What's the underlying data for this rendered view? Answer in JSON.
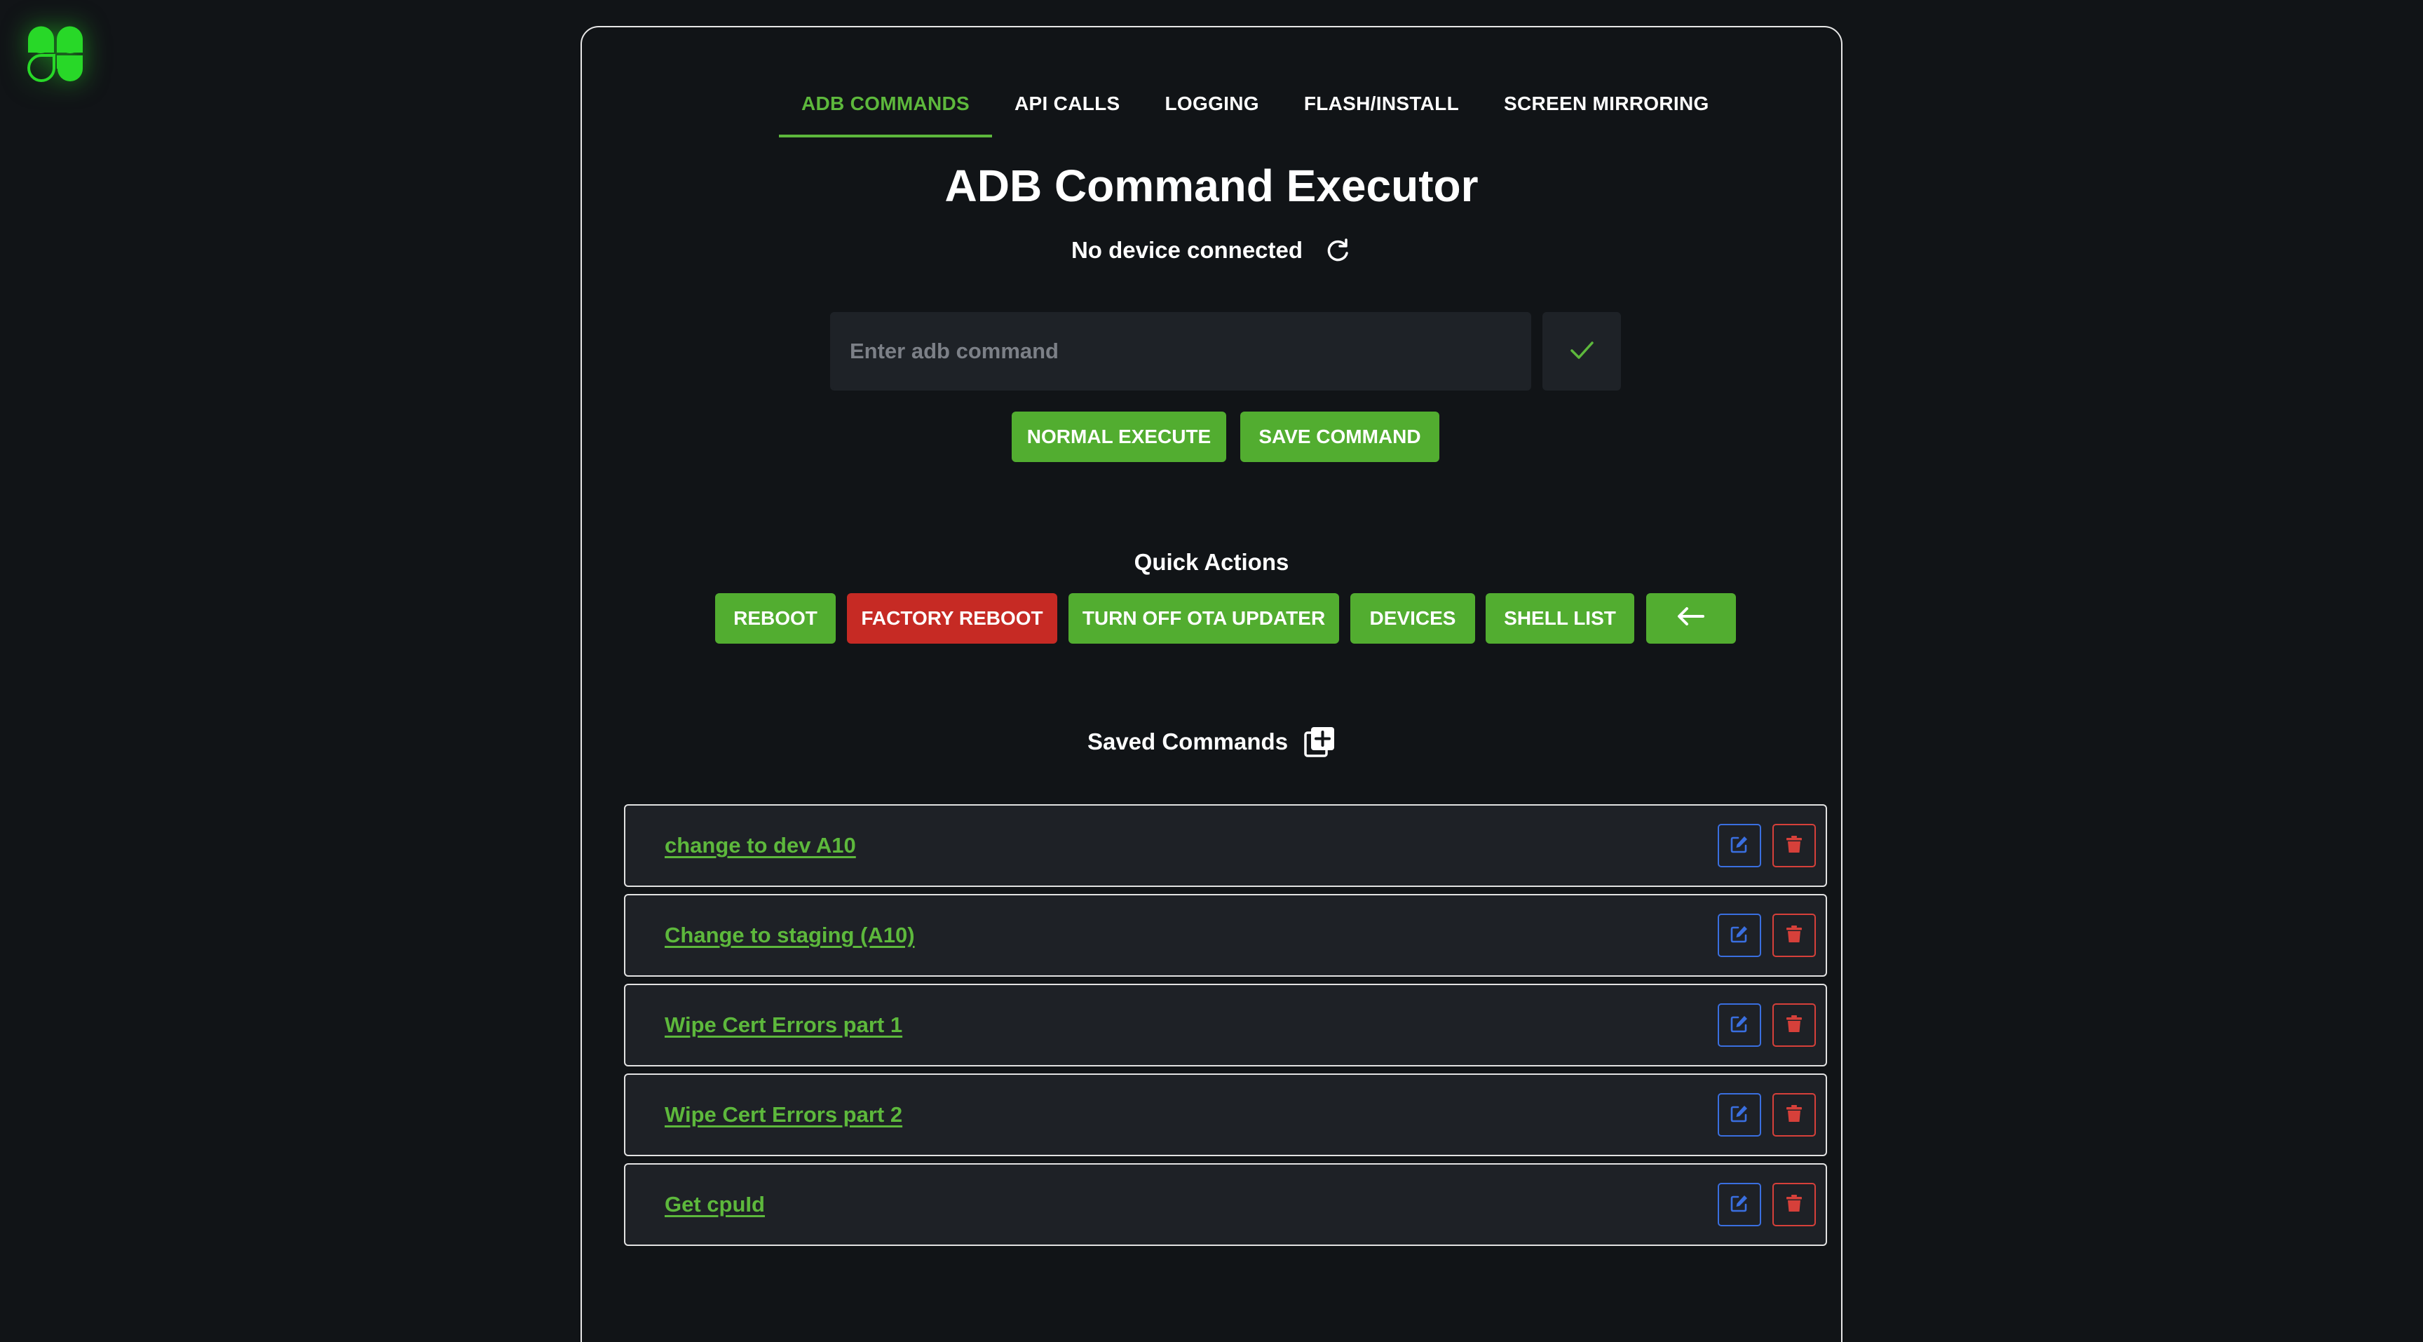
{
  "app": {
    "logo_icon": "clover-logo-icon",
    "accent_color": "#5db83c",
    "danger_color": "#c62a24",
    "edit_color": "#3a6fe0"
  },
  "tabs": [
    {
      "label": "ADB COMMANDS",
      "active": true
    },
    {
      "label": "API CALLS",
      "active": false
    },
    {
      "label": "LOGGING",
      "active": false
    },
    {
      "label": "FLASH/INSTALL",
      "active": false
    },
    {
      "label": "SCREEN MIRRORING",
      "active": false
    }
  ],
  "main": {
    "title": "ADB Command Executor",
    "status": "No device connected",
    "refresh_icon": "refresh-icon"
  },
  "command": {
    "value": "",
    "placeholder": "Enter adb command",
    "confirm_icon": "check-icon",
    "normal_execute_label": "NORMAL EXECUTE",
    "save_command_label": "SAVE COMMAND"
  },
  "quick_actions": {
    "title": "Quick Actions",
    "buttons": [
      {
        "label": "REBOOT",
        "style": "green"
      },
      {
        "label": "FACTORY REBOOT",
        "style": "red"
      },
      {
        "label": "TURN OFF OTA UPDATER",
        "style": "green"
      },
      {
        "label": "DEVICES",
        "style": "green"
      },
      {
        "label": "SHELL LIST",
        "style": "green"
      }
    ],
    "back_icon": "arrow-left-icon"
  },
  "saved_commands": {
    "title": "Saved Commands",
    "add_icon": "add-box-icon",
    "items": [
      {
        "label": "change to dev A10"
      },
      {
        "label": "Change to staging (A10)"
      },
      {
        "label": "Wipe Cert Errors part 1"
      },
      {
        "label": "Wipe Cert Errors part 2"
      },
      {
        "label": "Get cpuId"
      }
    ],
    "edit_icon": "edit-icon",
    "delete_icon": "trash-icon"
  }
}
